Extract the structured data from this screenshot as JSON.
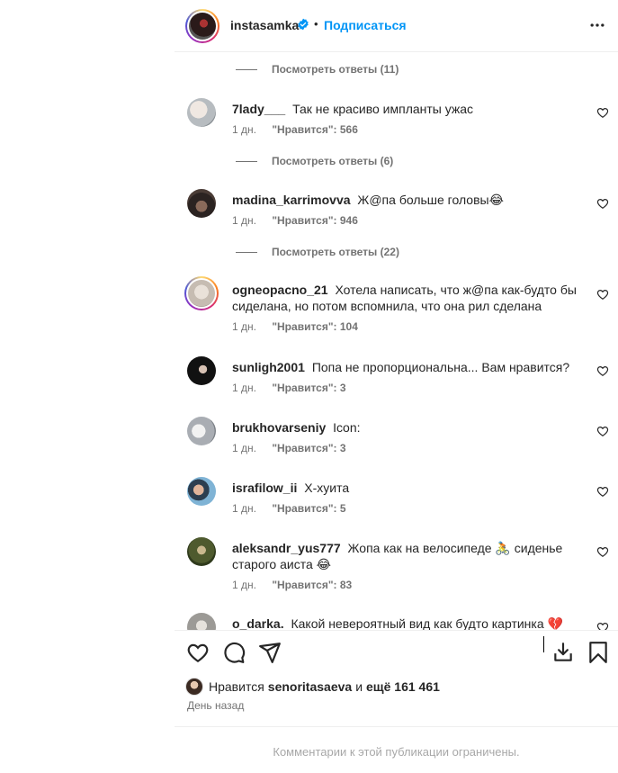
{
  "header": {
    "username": "instasamka",
    "separator": "•",
    "follow_label": "Подписаться",
    "verified": true
  },
  "comments": [
    {
      "type": "replies",
      "label": "Посмотреть ответы (11)"
    },
    {
      "type": "comment",
      "username": "7lady___",
      "text": "Так не красиво импланты ужас",
      "time": "1 дн.",
      "likes": "\"Нравится\": 566",
      "avatar_color": "#cfd3d6"
    },
    {
      "type": "replies",
      "label": "Посмотреть ответы (6)"
    },
    {
      "type": "comment",
      "username": "madina_karrimovva",
      "text": "Ж@па больше головы😂",
      "time": "1 дн.",
      "likes": "\"Нравится\": 946",
      "avatar_color": "#5a4a44"
    },
    {
      "type": "replies",
      "label": "Посмотреть ответы (22)"
    },
    {
      "type": "comment",
      "username": "ogneopacno_21",
      "text": "Хотела написать, что ж@па как-будто бы сиделана, но потом вспомнила, что она рил сделана",
      "time": "1 дн.",
      "likes": "\"Нравится\": 104",
      "avatar_color": "#d8cfc6",
      "story_ring": true
    },
    {
      "type": "comment",
      "username": "sunligh2001",
      "text": "Попа не пропорциональна... Вам нравится?",
      "time": "1 дн.",
      "likes": "\"Нравится\": 3",
      "avatar_color": "#1c1c1c"
    },
    {
      "type": "comment",
      "username": "brukhovarseniy",
      "text": "Icon:",
      "time": "1 дн.",
      "likes": "\"Нравится\": 3",
      "avatar_color": "#b8bcc2"
    },
    {
      "type": "comment",
      "username": "israfilow_ii",
      "text": "Х-хуита",
      "time": "1 дн.",
      "likes": "\"Нравится\": 5",
      "avatar_color": "#6f9bc0"
    },
    {
      "type": "comment",
      "username": "aleksandr_yus777",
      "text": "Жопа как на велосипеде 🚴 сиденье старого аиста 😂",
      "time": "1 дн.",
      "likes": "\"Нравится\": 83",
      "avatar_color": "#5b6b3a"
    },
    {
      "type": "comment",
      "username": "o_darka.",
      "text": "Какой невероятный вид как будто картинка 💔",
      "time": "",
      "likes": "",
      "avatar_color": "#9c9a96"
    }
  ],
  "actions": {
    "icons": [
      "heart-icon",
      "comment-icon",
      "share-icon",
      "download-icon",
      "bookmark-icon"
    ],
    "likes_prefix": "Нравится",
    "likes_user": "senoritasaeva",
    "likes_mid": "и",
    "likes_rest": "ещё 161 461",
    "date": "День назад"
  },
  "footer": {
    "restricted": "Комментарии к этой публикации ограничены."
  },
  "colors": {
    "link": "#0095f6",
    "text": "#262626",
    "muted": "#737373",
    "divider": "#efefef"
  }
}
